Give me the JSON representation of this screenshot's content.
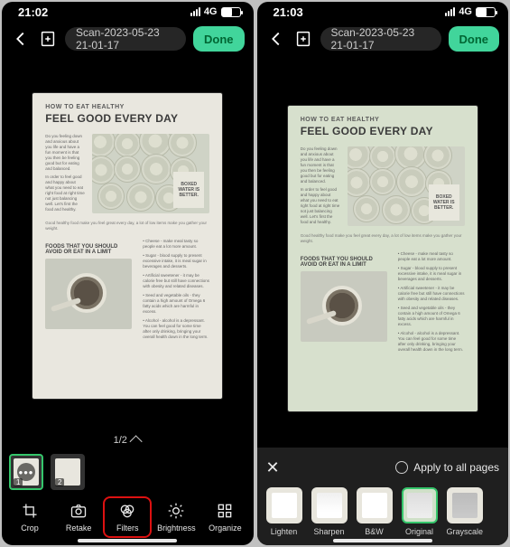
{
  "left": {
    "status_time": "21:02",
    "net": "4G",
    "file_title": "Scan-2023-05-23 21-01-17",
    "done": "Done",
    "page_indicator": "1/2",
    "thumbs": [
      "1",
      "2"
    ],
    "tools": [
      {
        "label": "Crop"
      },
      {
        "label": "Retake"
      },
      {
        "label": "Filters"
      },
      {
        "label": "Brightness"
      },
      {
        "label": "Organize"
      }
    ]
  },
  "right": {
    "status_time": "21:03",
    "net": "4G",
    "file_title": "Scan-2023-05-23 21-01-17",
    "done": "Done",
    "apply_label": "Apply to all pages",
    "filters": [
      {
        "label": "Lighten"
      },
      {
        "label": "Sharpen"
      },
      {
        "label": "B&W"
      },
      {
        "label": "Original"
      },
      {
        "label": "Grayscale"
      }
    ]
  },
  "doc": {
    "sub": "HOW TO EAT HEALTHY",
    "title": "FEEL GOOD EVERY DAY",
    "badge": "BOXED WATER IS BETTER.",
    "h3": "FOODS THAT YOU SHOULD AVOID OR EAT IN A LIMIT"
  }
}
